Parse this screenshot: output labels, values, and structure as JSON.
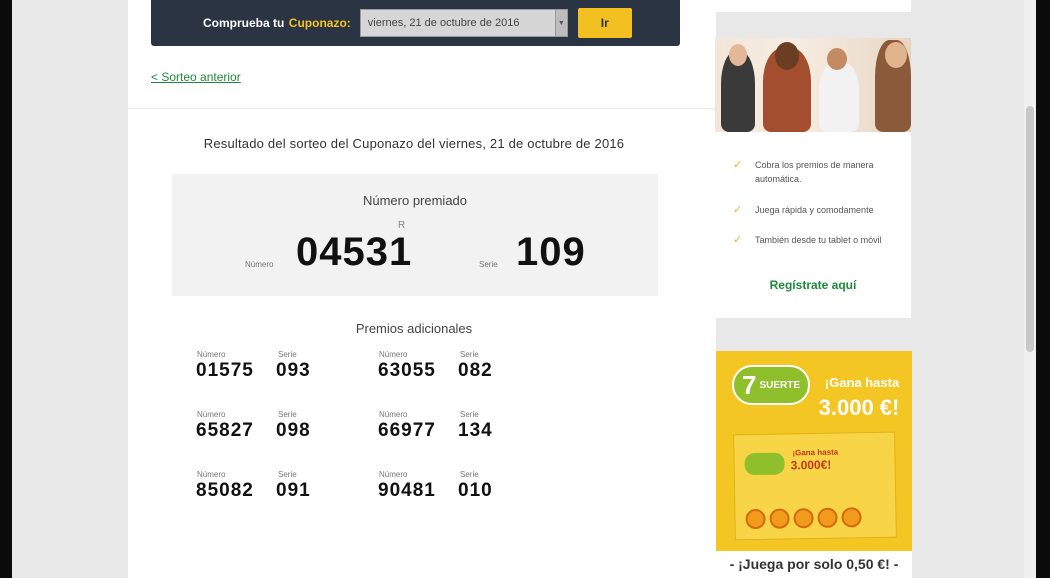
{
  "check_bar": {
    "label": "Comprueba tu",
    "brand": "Cuponazo:",
    "selected_date": "viernes, 21 de octubre de 2016",
    "go_button": "Ir"
  },
  "nav": {
    "prev_link": "< Sorteo anterior"
  },
  "result": {
    "title": "Resultado del sorteo del Cuponazo del viernes, 21 de octubre de 2016",
    "winner_heading": "Número premiado",
    "r_mark": "R",
    "numero_label": "Número",
    "serie_label": "Serie",
    "numero": "04531",
    "serie": "109"
  },
  "extras": {
    "title": "Premios adicionales",
    "numero_label": "Número",
    "serie_label": "Serie",
    "items": [
      {
        "numero": "01575",
        "serie": "093"
      },
      {
        "numero": "63055",
        "serie": "082"
      },
      {
        "numero": "65827",
        "serie": "098"
      },
      {
        "numero": "66977",
        "serie": "134"
      },
      {
        "numero": "85082",
        "serie": "091"
      },
      {
        "numero": "90481",
        "serie": "010"
      }
    ]
  },
  "sidebar": {
    "benefits": [
      "Cobra los premios de manera automática.",
      "Juega rápida y comodamente",
      "También desde tu tablet o móvil"
    ],
    "register_link": "Regístrate aquí"
  },
  "ad": {
    "logo_seven": "7",
    "logo_text": "SUERTE",
    "headline": "¡Gana hasta",
    "amount": "3.000 €!",
    "ticket_headline": "¡Gana hasta",
    "ticket_amount": "3.000€!",
    "tagline": "- ¡Juega por solo 0,50 €! -"
  },
  "colors": {
    "accent_yellow": "#f2c021",
    "dark_bar": "#2a3443",
    "link_green": "#1f8a3b"
  }
}
